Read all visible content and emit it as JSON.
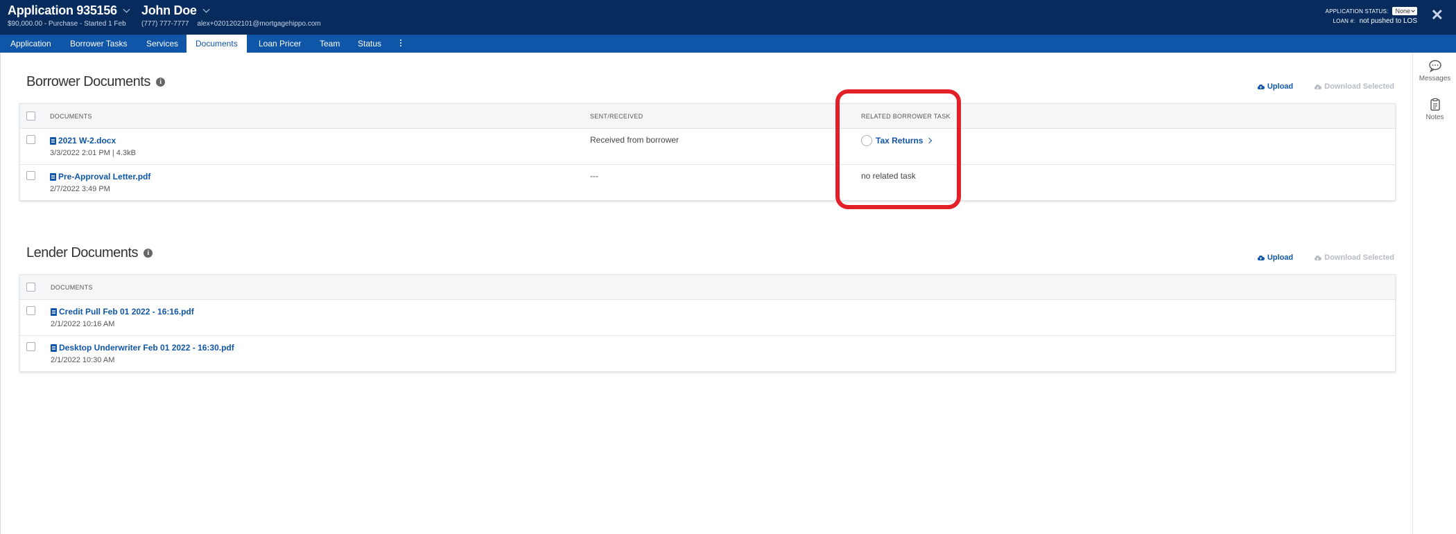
{
  "header": {
    "app_title": "Application 935156",
    "app_sub": "$90,000.00 - Purchase - Started 1 Feb",
    "borrower_name": "John Doe",
    "borrower_phone": "(777) 777-7777",
    "borrower_email": "alex+0201202101@mortgagehippo.com",
    "status_label": "APPLICATION STATUS:",
    "status_value": "None",
    "loan_label": "LOAN #:",
    "loan_value": "not pushed to LOS",
    "close": "✕"
  },
  "tabs": [
    {
      "label": "Application"
    },
    {
      "label": "Borrower Tasks"
    },
    {
      "label": "Services"
    },
    {
      "label": "Documents"
    },
    {
      "label": "Loan Pricer"
    },
    {
      "label": "Team"
    },
    {
      "label": "Status"
    }
  ],
  "rail": {
    "messages": "Messages",
    "notes": "Notes"
  },
  "borrower_docs": {
    "title": "Borrower Documents",
    "upload": "Upload",
    "download": "Download Selected",
    "col_documents": "DOCUMENTS",
    "col_sent": "SENT/RECEIVED",
    "col_task": "RELATED BORROWER TASK",
    "rows": [
      {
        "name": "2021 W-2.docx",
        "meta": "3/3/2022 2:01 PM | 4.3kB",
        "sent": "Received from borrower",
        "task": "Tax Returns"
      },
      {
        "name": "Pre-Approval Letter.pdf",
        "meta": "2/7/2022 3:49 PM",
        "sent": "---",
        "task": "no related task"
      }
    ]
  },
  "lender_docs": {
    "title": "Lender Documents",
    "upload": "Upload",
    "download": "Download Selected",
    "col_documents": "DOCUMENTS",
    "rows": [
      {
        "name": "Credit Pull Feb 01 2022 - 16:16.pdf",
        "meta": "2/1/2022 10:16 AM"
      },
      {
        "name": "Desktop Underwriter Feb 01 2022 - 16:30.pdf",
        "meta": "2/1/2022 10:30 AM"
      }
    ]
  },
  "colors": {
    "header_bg": "#062b5c",
    "tab_bg": "#0f55a8",
    "link": "#0f55a8",
    "highlight": "#e32028"
  }
}
